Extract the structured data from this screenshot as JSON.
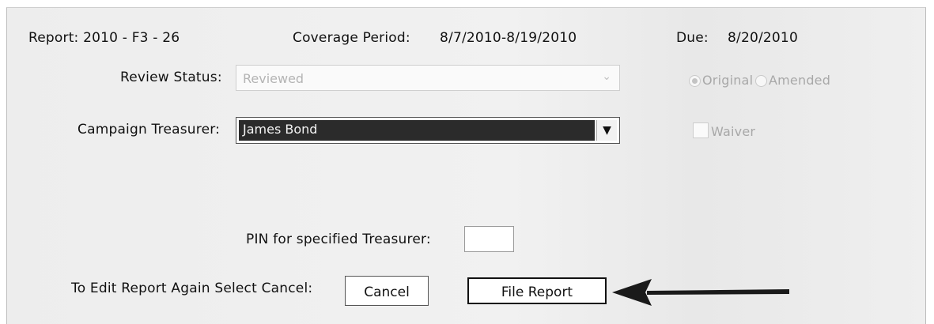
{
  "header": {
    "report": "Report: 2010 - F3 - 26",
    "coverage_label": "Coverage Period:",
    "coverage_value": "8/7/2010-8/19/2010",
    "due_label": "Due:",
    "due_value": "8/20/2010"
  },
  "review_status": {
    "label": "Review Status:",
    "value": "Reviewed",
    "disabled": true
  },
  "report_type": {
    "options": [
      "Original",
      "Amended"
    ],
    "selected": "Original"
  },
  "treasurer": {
    "label": "Campaign Treasurer:",
    "value": "James Bond"
  },
  "waiver": {
    "label": "Waiver",
    "checked": false
  },
  "pin": {
    "label": "PIN for specified Treasurer:",
    "value": ""
  },
  "actions": {
    "hint": "To Edit Report Again Select Cancel:",
    "cancel_label": "Cancel",
    "file_label": "File Report"
  },
  "annotation": {
    "icon": "arrow-left-icon",
    "color": "#1a1a1a"
  }
}
